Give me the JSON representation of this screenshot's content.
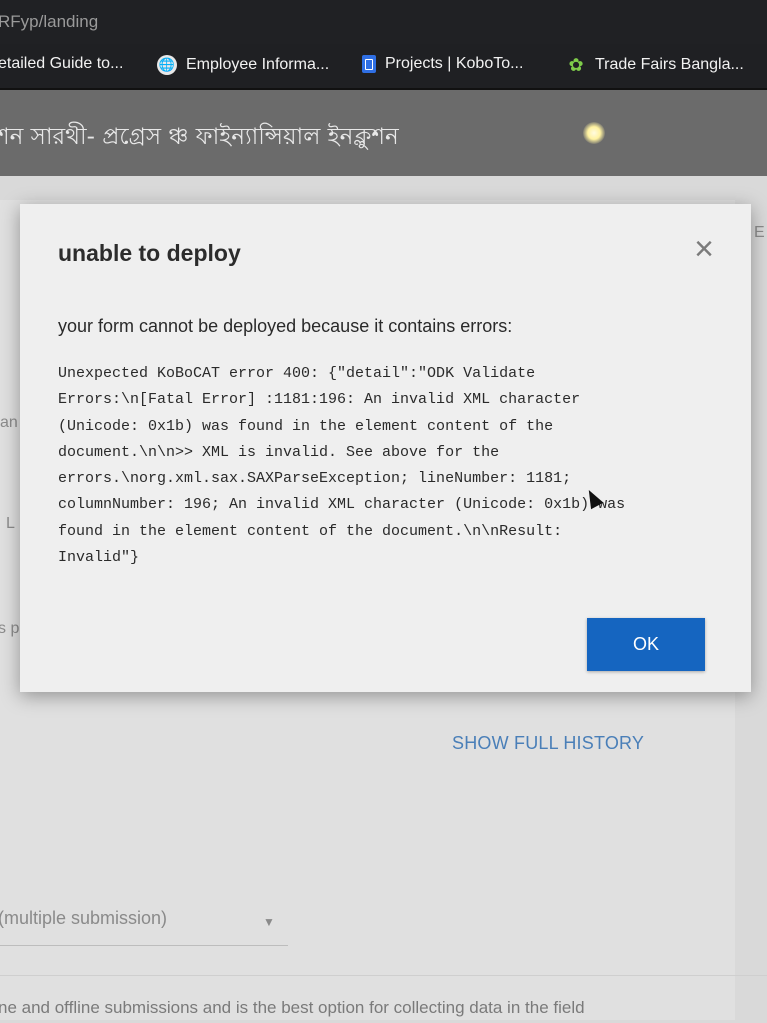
{
  "browser": {
    "url": "RFyp/landing",
    "bookmarks": [
      {
        "label": "etailed Guide to...",
        "icon": ""
      },
      {
        "label": "Employee Informa...",
        "icon": "globe-icon"
      },
      {
        "label": "Projects | KoboTo...",
        "icon": "document-icon"
      },
      {
        "label": "Trade Fairs Bangla...",
        "icon": "fair-icon"
      }
    ]
  },
  "page": {
    "title": "শন সারথী- প্রগ্রেস ঞ্চ ফাইন্যান্সিয়াল ইনক্লুশন",
    "side_labels": [
      "an",
      "L",
      "s p",
      "E"
    ],
    "show_history": "SHOW FULL HISTORY",
    "submission_select": "(multiple submission)",
    "bottom_text": "ne and offline submissions and is the best option for collecting data in the field"
  },
  "modal": {
    "title": "unable to deploy",
    "message": "your form cannot be deployed because it contains errors:",
    "error_lines": [
      "Unexpected KoBoCAT error 400: {\"detail\":\"ODK Validate",
      "Errors:\\n[Fatal Error] :1181:196: An invalid XML character",
      "(Unicode: 0x1b) was found in the element content of the",
      "document.\\n\\n>> XML is invalid. See above for the",
      "errors.\\norg.xml.sax.SAXParseException; lineNumber: 1181;",
      "columnNumber: 196; An invalid XML character (Unicode: 0x1b) was",
      "found in the element content of the document.\\n\\nResult:",
      "Invalid\"}"
    ],
    "ok_label": "OK",
    "close_icon": "close-icon"
  },
  "colors": {
    "primary_button": "#1565c0",
    "link": "#4a7fb8",
    "header_bg": "#6b6b6b",
    "chrome_bg": "#202124"
  }
}
